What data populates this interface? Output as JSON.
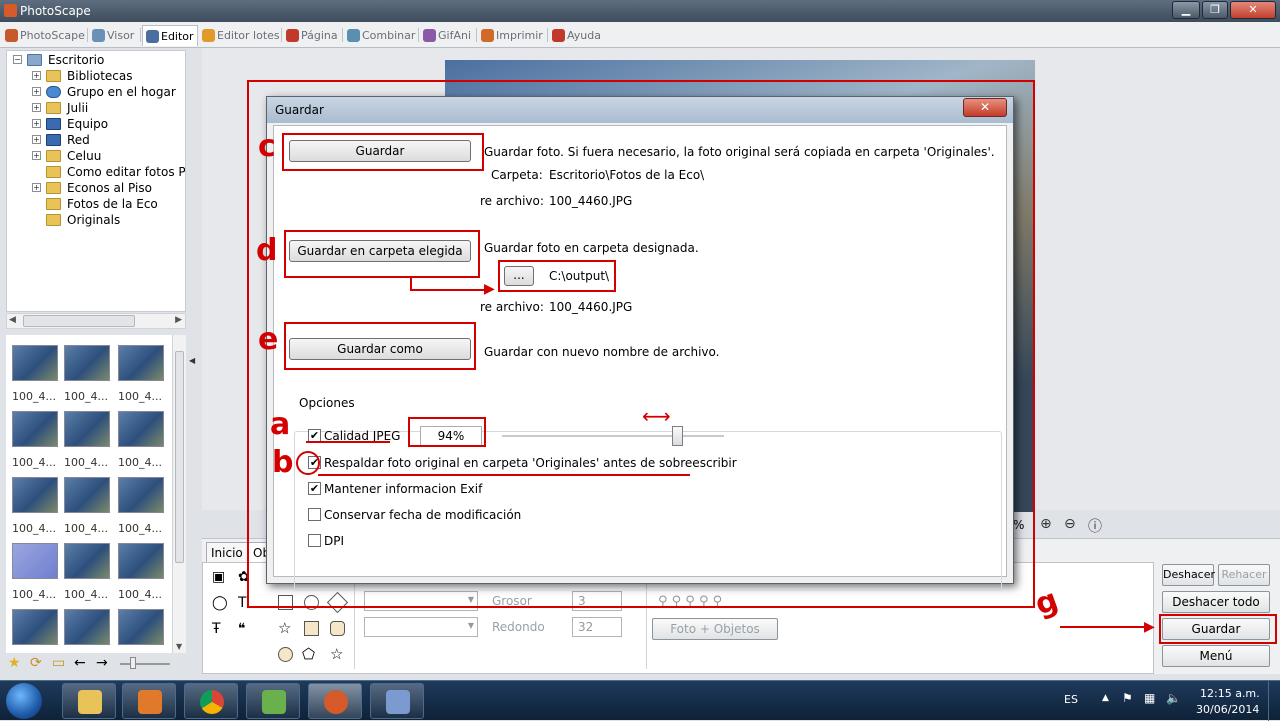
{
  "window": {
    "title": "PhotoScape",
    "minimize": "▁",
    "maximize": "❐",
    "close": "✕"
  },
  "tabs": [
    {
      "label": "PhotoScape",
      "color": "#c75a2a"
    },
    {
      "label": "Visor",
      "color": "#6a8fb8"
    },
    {
      "label": "Editor",
      "color": "#4a6ea0"
    },
    {
      "label": "Editor lotes",
      "color": "#e09a2a"
    },
    {
      "label": "Página",
      "color": "#c0392b"
    },
    {
      "label": "Combinar",
      "color": "#5a8fb0"
    },
    {
      "label": "GifAni",
      "color": "#8a5aa8"
    },
    {
      "label": "Imprimir",
      "color": "#d06a2a"
    },
    {
      "label": "Ayuda",
      "color": "#c0392b"
    }
  ],
  "tree": {
    "root": "Escritorio",
    "items": [
      "Bibliotecas",
      "Grupo en el hogar",
      "Julii",
      "Equipo",
      "Red",
      "Celuu",
      "Como editar fotos Pho",
      "Econos al Piso",
      "Fotos de la Eco",
      "Originals"
    ]
  },
  "thumbnail_label": "100_4...",
  "panel": {
    "tab_inicio": "Inicio",
    "tab_ob": "Ob",
    "grosor_label": "Grosor",
    "grosor_value": "3",
    "redondo_label": "Redondo",
    "redondo_value": "32",
    "foto_objetos": "Foto + Objetos",
    "zoom_pct": "%"
  },
  "right_buttons": {
    "deshacer": "Deshacer",
    "rehacer": "Rehacer",
    "deshacer_todo": "Deshacer todo",
    "guardar": "Guardar",
    "menu": "Menú"
  },
  "dialog": {
    "title": "Guardar",
    "close": "✕",
    "guardar_btn": "Guardar",
    "guardar_desc": "Guardar foto. Si fuera necesario, la foto original será copiada en carpeta 'Originales'.",
    "carpeta_label": "Carpeta:",
    "carpeta_value": "Escritorio\\Fotos de la Eco\\",
    "archivo_label": "re archivo:",
    "archivo_value": "100_4460.JPG",
    "elegida_btn": "Guardar en carpeta elegida",
    "elegida_desc": "Guardar foto en carpeta designada.",
    "browse_btn": "...",
    "output_path": "C:\\output\\",
    "archivo2_value": "100_4460.JPG",
    "como_btn": "Guardar como",
    "como_desc": "Guardar con nuevo nombre de archivo.",
    "opciones": "Opciones",
    "calidad": "Calidad JPEG",
    "calidad_value": "94%",
    "respaldar": "Respaldar foto original en carpeta 'Originales' antes de sobreescribir",
    "exif": "Mantener informacion Exif",
    "fecha": "Conservar fecha de modificación",
    "dpi": "DPI",
    "checkbox_states": {
      "calidad": true,
      "respaldar": true,
      "exif": true,
      "fecha": false,
      "dpi": false
    }
  },
  "annotations": {
    "a": "a",
    "b": "b",
    "c": "c",
    "d": "d",
    "e": "e",
    "g": "g",
    "accent": "#d40000"
  },
  "taskbar": {
    "language": "ES",
    "time": "12:15 a.m.",
    "date": "30/06/2014"
  }
}
